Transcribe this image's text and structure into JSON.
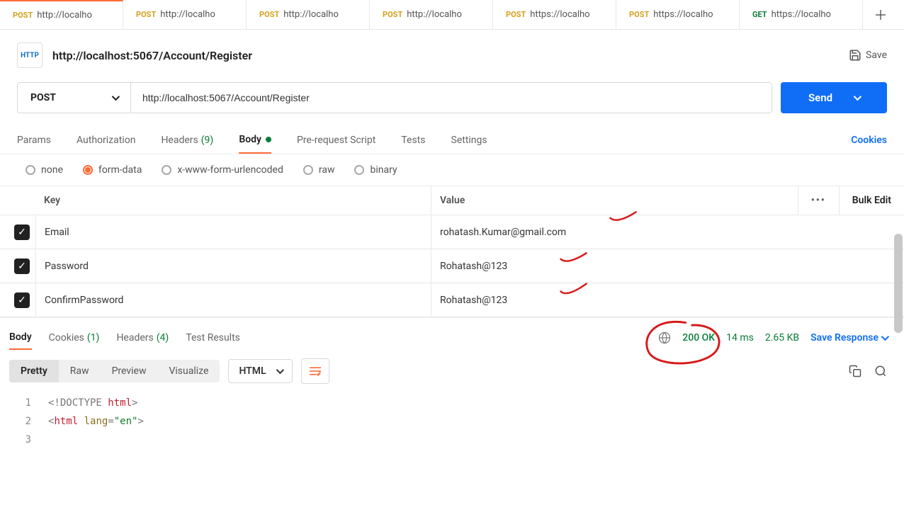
{
  "tabs": [
    {
      "method": "POST",
      "methodClass": "post",
      "title": "http://localho"
    },
    {
      "method": "POST",
      "methodClass": "post",
      "title": "http://localho"
    },
    {
      "method": "POST",
      "methodClass": "post",
      "title": "http://localho"
    },
    {
      "method": "POST",
      "methodClass": "post",
      "title": "http://localho"
    },
    {
      "method": "POST",
      "methodClass": "post",
      "title": "https://localho"
    },
    {
      "method": "POST",
      "methodClass": "post",
      "title": "https://localho"
    },
    {
      "method": "GET",
      "methodClass": "get",
      "title": "https://localho"
    }
  ],
  "request": {
    "http_badge": "HTTP",
    "title": "http://localhost:5067/Account/Register",
    "save_label": "Save",
    "method": "POST",
    "url": "http://localhost:5067/Account/Register",
    "send_label": "Send"
  },
  "req_subtabs": {
    "params": "Params",
    "auth": "Authorization",
    "headers": "Headers",
    "headers_count": "(9)",
    "body": "Body",
    "prereq": "Pre-request Script",
    "tests": "Tests",
    "settings": "Settings",
    "cookies": "Cookies"
  },
  "body_types": {
    "none": "none",
    "formdata": "form-data",
    "xwww": "x-www-form-urlencoded",
    "raw": "raw",
    "binary": "binary"
  },
  "fd_headers": {
    "key": "Key",
    "value": "Value",
    "bulk": "Bulk Edit"
  },
  "fd_rows": [
    {
      "key": "Email",
      "value": "rohatash.Kumar@gmail.com"
    },
    {
      "key": "Password",
      "value": "Rohatash@123"
    },
    {
      "key": "ConfirmPassword",
      "value": "Rohatash@123"
    }
  ],
  "resp_tabs": {
    "body": "Body",
    "cookies": "Cookies",
    "cookies_count": "(1)",
    "headers": "Headers",
    "headers_count": "(4)",
    "test_results": "Test Results"
  },
  "resp_status": {
    "status": "200 OK",
    "time": "14 ms",
    "size": "2.65 KB",
    "save": "Save Response"
  },
  "viewmodes": {
    "pretty": "Pretty",
    "raw": "Raw",
    "preview": "Preview",
    "visualize": "Visualize"
  },
  "lang": "HTML",
  "code": {
    "l1_a": "<!DOCTYPE ",
    "l1_b": "html",
    "l1_c": ">",
    "l2_a": "<",
    "l2_b": "html",
    "l2_c": " lang",
    "l2_d": "=",
    "l2_e": "\"en\"",
    "l2_f": ">"
  }
}
